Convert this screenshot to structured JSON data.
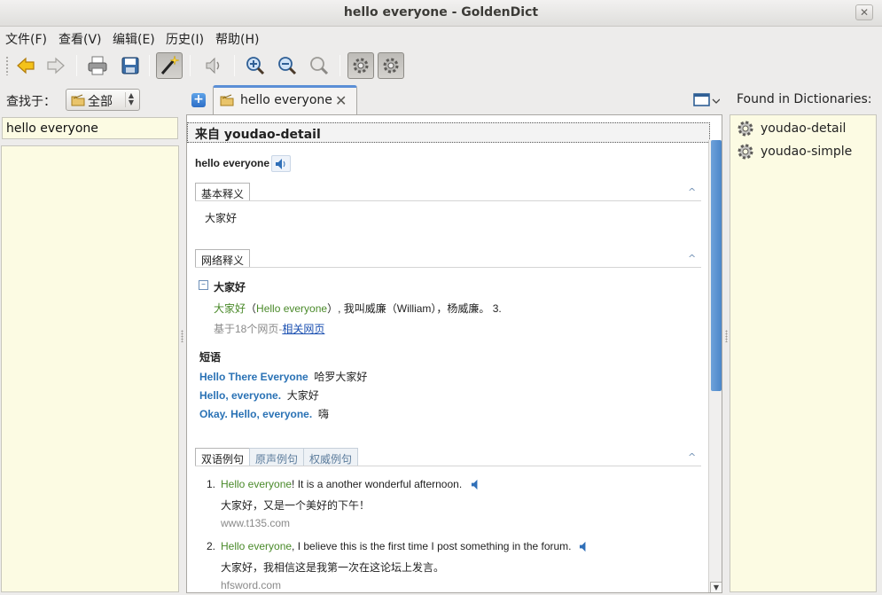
{
  "window": {
    "title": "hello everyone - GoldenDict",
    "close_glyph": "✕"
  },
  "menu": [
    {
      "label": "文件(F)"
    },
    {
      "label": "查看(V)"
    },
    {
      "label": "编辑(E)"
    },
    {
      "label": "历史(I)"
    },
    {
      "label": "帮助(H)"
    }
  ],
  "toolbar": {
    "items": [
      "back-icon",
      "forward-icon",
      "print-icon",
      "save-icon",
      "scan-popup-icon",
      "pronounce-icon",
      "zoom-in-icon",
      "zoom-out-icon",
      "zoom-reset-icon",
      "settings-icon",
      "dictionaries-icon"
    ],
    "active": "scan-popup-icon"
  },
  "left_pane": {
    "lookup_label": "查找于：",
    "group_value": "全部",
    "search_value": "hello everyone"
  },
  "tabs": [
    {
      "label": "hello everyone",
      "active": true
    }
  ],
  "article": {
    "dict_header_prefix": "来自 ",
    "dict_name": "youdao-detail",
    "headword": "hello everyone",
    "basic": {
      "tab": "基本释义",
      "meaning": "大家好"
    },
    "web": {
      "tab": "网络释义",
      "entry_word": "大家好",
      "entry_line": {
        "green_part": "大家好",
        "paren_open": "（",
        "green_inner": "Hello everyone",
        "rest": "）, 我叫威廉（William），杨威廉。 3."
      },
      "source_prefix": "基于18个网页-",
      "source_link": "相关网页",
      "phrases_title": "短语",
      "phrases": [
        {
          "en": "Hello There Everyone",
          "zh": "哈罗大家好"
        },
        {
          "en": "Hello, everyone.",
          "zh": "大家好"
        },
        {
          "en": "Okay. Hello, everyone.",
          "zh": "嗨"
        }
      ]
    },
    "examples": {
      "tabs": [
        "双语例句",
        "原声例句",
        "权威例句"
      ],
      "items": [
        {
          "num": "1.",
          "green": "Hello everyone",
          "en_rest": "! It is a another wonderful afternoon.",
          "zh": "大家好，又是一个美好的下午！",
          "source": "www.t135.com"
        },
        {
          "num": "2.",
          "green": "Hello everyone",
          "en_rest": ", I believe this is the first time I post something in the forum.",
          "zh": "大家好，我相信这是我第一次在这论坛上发言。",
          "source": "hfsword.com"
        }
      ]
    },
    "collapse_glyph": "^"
  },
  "right_pane": {
    "title": "Found in Dictionaries:",
    "dictionaries": [
      "youdao-detail",
      "youdao-simple"
    ]
  },
  "colors": {
    "accent": "#2a72b5",
    "green": "#4a8a2a",
    "panel_bg": "#fcfbe3"
  }
}
